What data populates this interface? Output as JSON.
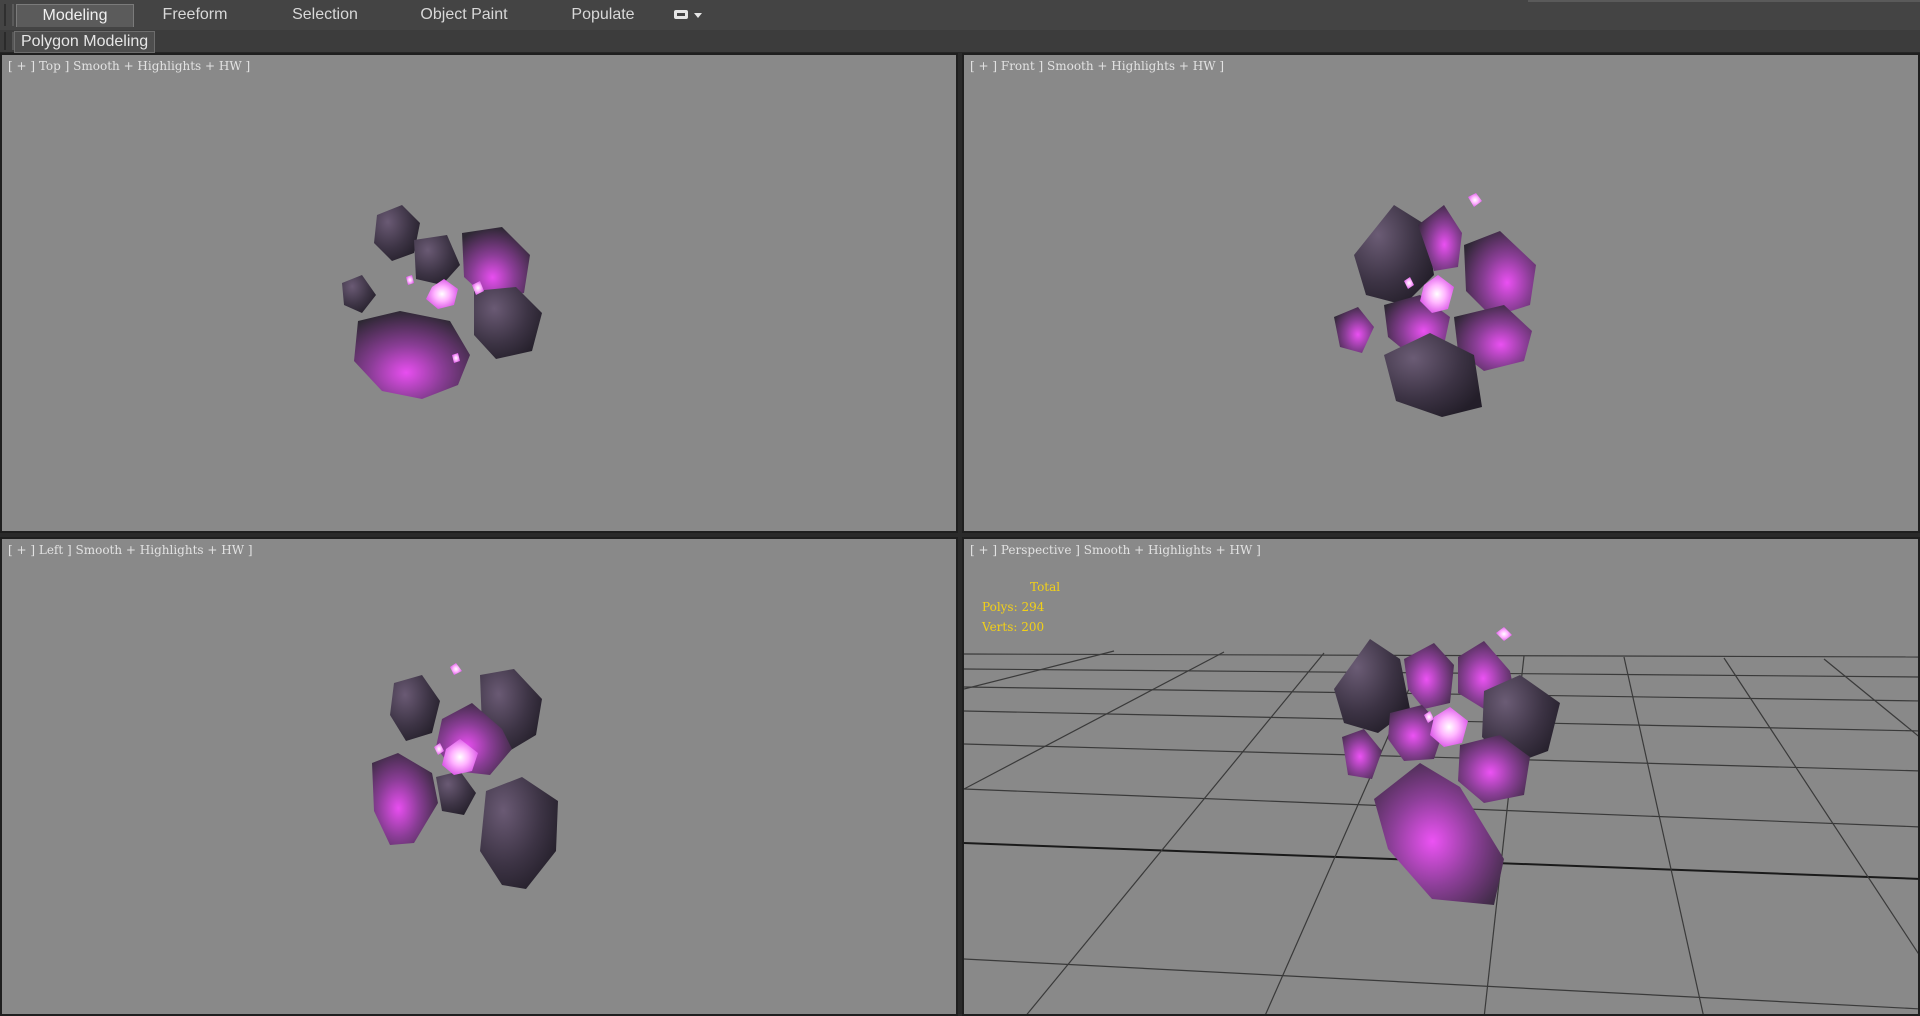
{
  "tabs": [
    {
      "label": "Modeling",
      "active": true
    },
    {
      "label": "Freeform",
      "active": false
    },
    {
      "label": "Selection",
      "active": false
    },
    {
      "label": "Object Paint",
      "active": false
    },
    {
      "label": "Populate",
      "active": false
    }
  ],
  "ribbon": {
    "label": "Polygon Modeling"
  },
  "viewports": {
    "top": {
      "label": "[ + ] Top ] Smooth + Highlights + HW ]"
    },
    "front": {
      "label": "[ + ] Front ] Smooth + Highlights + HW ]"
    },
    "left": {
      "label": "[ + ] Left ] Smooth + Highlights + HW ]"
    },
    "perspective": {
      "label": "[ + ] Perspective ] Smooth + Highlights + HW ]"
    }
  },
  "stats": {
    "header": "Total",
    "polys": "Polys: 294",
    "verts": "Verts: 200"
  },
  "colors": {
    "viewport_bg": "#898989",
    "stats_text": "#f2d018",
    "crystal_glow": "#e040f0",
    "rock_dark": "#3a3040"
  },
  "icons": {
    "tab_overflow": "overflow-menu-icon"
  }
}
